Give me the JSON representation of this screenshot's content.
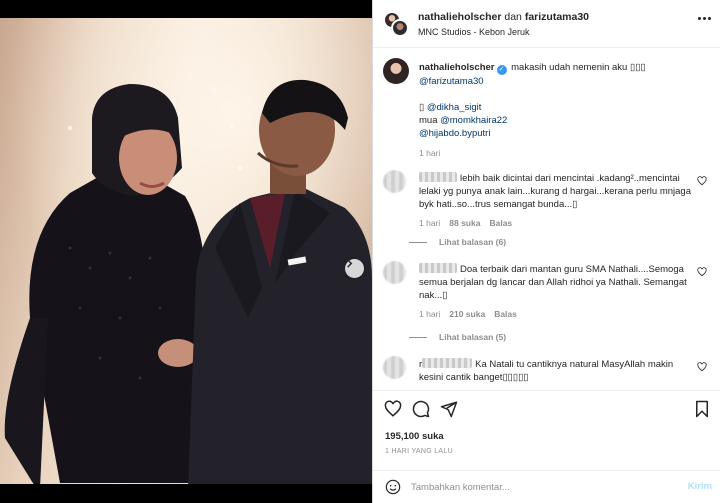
{
  "header": {
    "user1": "nathalieholscher",
    "and": "dan",
    "user2": "farizutama30",
    "location": "MNC Studios - Kebon Jeruk",
    "more_icon": "more-horizontal-icon"
  },
  "caption": {
    "username": "nathalieholscher",
    "text": "makasih udah nemenin aku",
    "emoji": "▯▯▯",
    "mention1": "@farizutama30",
    "line2_prefix": "▯",
    "mention2": "@dikha_sigit",
    "mua_label": "mua",
    "mention3": "@momkhaira22",
    "mention4": "@hijabdo.byputri",
    "time": "1 hari"
  },
  "comments": [
    {
      "text": "lebih baik dicintai dari mencintai .kadang²..mencintai lelaki yg punya anak lain...kurang d hargai...kerana perlu mnjaga byk hati..so...trus semangat bunda...▯",
      "time": "1 hari",
      "likes": "88 suka",
      "reply": "Balas",
      "replies": "Lihat balasan (6)"
    },
    {
      "text": "Doa terbaik dari mantan guru SMA Nathali....Semoga semua berjalan dg lancar dan Allah ridhoi ya Nathali. Semangat nak...▯",
      "time": "1 hari",
      "likes": "210 suka",
      "reply": "Balas",
      "replies": "Lihat balasan (5)"
    },
    {
      "name_fragment": "r",
      "text": "Ka Natali tu cantiknya natural MasyAllah makin kesini cantik banget▯▯▯▯▯"
    }
  ],
  "actions": {
    "likes": "195,100 suka",
    "time_ago": "1 HARI YANG LALU"
  },
  "add_comment": {
    "placeholder": "Tambahkan komentar...",
    "post": "Kirim"
  },
  "colors": {
    "accent": "#3897f0",
    "link": "#00376b",
    "muted": "#8e8e8e",
    "post_disabled": "#b2dffc"
  }
}
